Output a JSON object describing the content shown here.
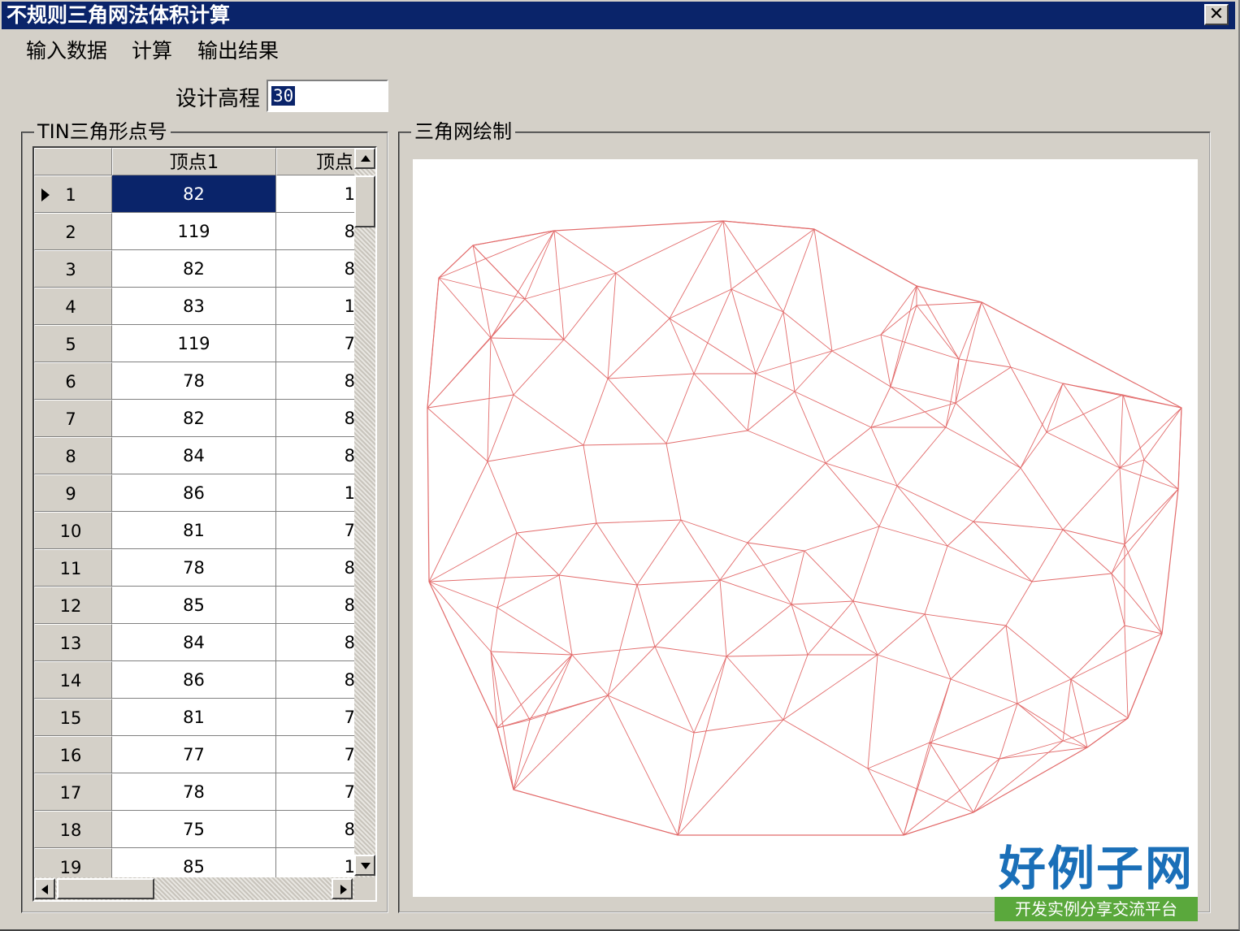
{
  "window": {
    "title": "不规则三角网法体积计算",
    "close_label": "✕"
  },
  "menu": [
    "输入数据",
    "计算",
    "输出结果"
  ],
  "design": {
    "label": "设计高程",
    "value": "30"
  },
  "left_group": {
    "title": "TIN三角形点号",
    "columns": [
      "顶点1",
      "顶点"
    ],
    "rows": [
      {
        "n": "1",
        "v1": "82",
        "v2": "1"
      },
      {
        "n": "2",
        "v1": "119",
        "v2": "8"
      },
      {
        "n": "3",
        "v1": "82",
        "v2": "8"
      },
      {
        "n": "4",
        "v1": "83",
        "v2": "1"
      },
      {
        "n": "5",
        "v1": "119",
        "v2": "7"
      },
      {
        "n": "6",
        "v1": "78",
        "v2": "8"
      },
      {
        "n": "7",
        "v1": "82",
        "v2": "8"
      },
      {
        "n": "8",
        "v1": "84",
        "v2": "8"
      },
      {
        "n": "9",
        "v1": "86",
        "v2": "1"
      },
      {
        "n": "10",
        "v1": "81",
        "v2": "7"
      },
      {
        "n": "11",
        "v1": "78",
        "v2": "8"
      },
      {
        "n": "12",
        "v1": "85",
        "v2": "8"
      },
      {
        "n": "13",
        "v1": "84",
        "v2": "8"
      },
      {
        "n": "14",
        "v1": "86",
        "v2": "8"
      },
      {
        "n": "15",
        "v1": "81",
        "v2": "7"
      },
      {
        "n": "16",
        "v1": "77",
        "v2": "7"
      },
      {
        "n": "17",
        "v1": "78",
        "v2": "7"
      },
      {
        "n": "18",
        "v1": "75",
        "v2": "8"
      },
      {
        "n": "19",
        "v1": "85",
        "v2": "1"
      }
    ]
  },
  "right_group": {
    "title": "三角网绘制",
    "line_color": "#e26a6a"
  },
  "brand": {
    "title": "好例子网",
    "subtitle": "开发实例分享交流平台",
    "title_color": "#1a6fb8",
    "subtitle_bg": "#5aa83c"
  }
}
